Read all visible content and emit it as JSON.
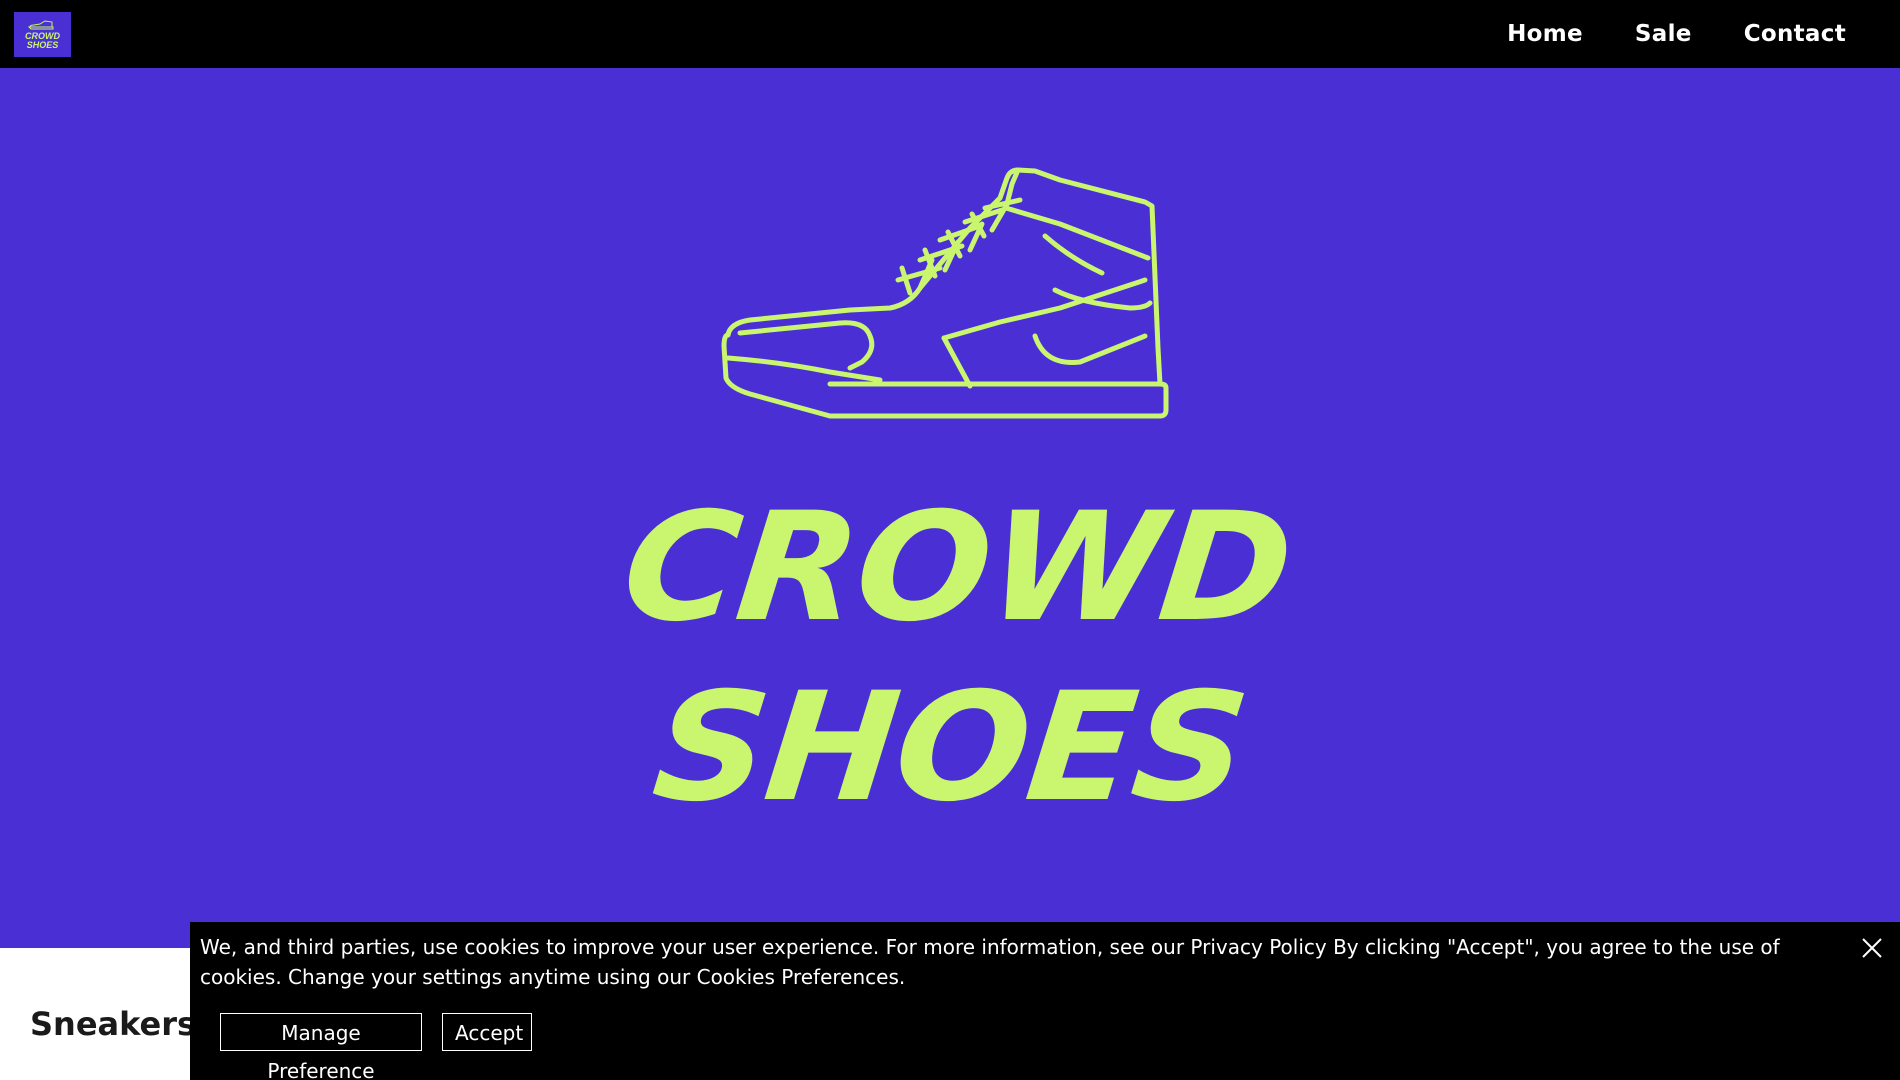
{
  "header": {
    "logo_line1": "CROWD",
    "logo_line2": "SHOES",
    "nav": [
      {
        "label": "Home"
      },
      {
        "label": "Sale"
      },
      {
        "label": "Contact"
      }
    ]
  },
  "hero": {
    "brand_line1": "CROWD",
    "brand_line2": "SHOES"
  },
  "section": {
    "title": "Sneakers"
  },
  "cookie_banner": {
    "text": "We, and third parties, use cookies to improve your user experience. For more information, see our Privacy Policy By clicking \"Accept\", you agree to the use of cookies. Change your settings anytime using our Cookies Preferences.",
    "manage_label": "Manage Preference",
    "accept_label": "Accept"
  },
  "colors": {
    "brand_purple": "#4a30d4",
    "brand_lime": "#c9f56f",
    "header_bg": "#000000"
  },
  "icons": {
    "logo": "sneaker-icon",
    "close": "close-icon"
  }
}
